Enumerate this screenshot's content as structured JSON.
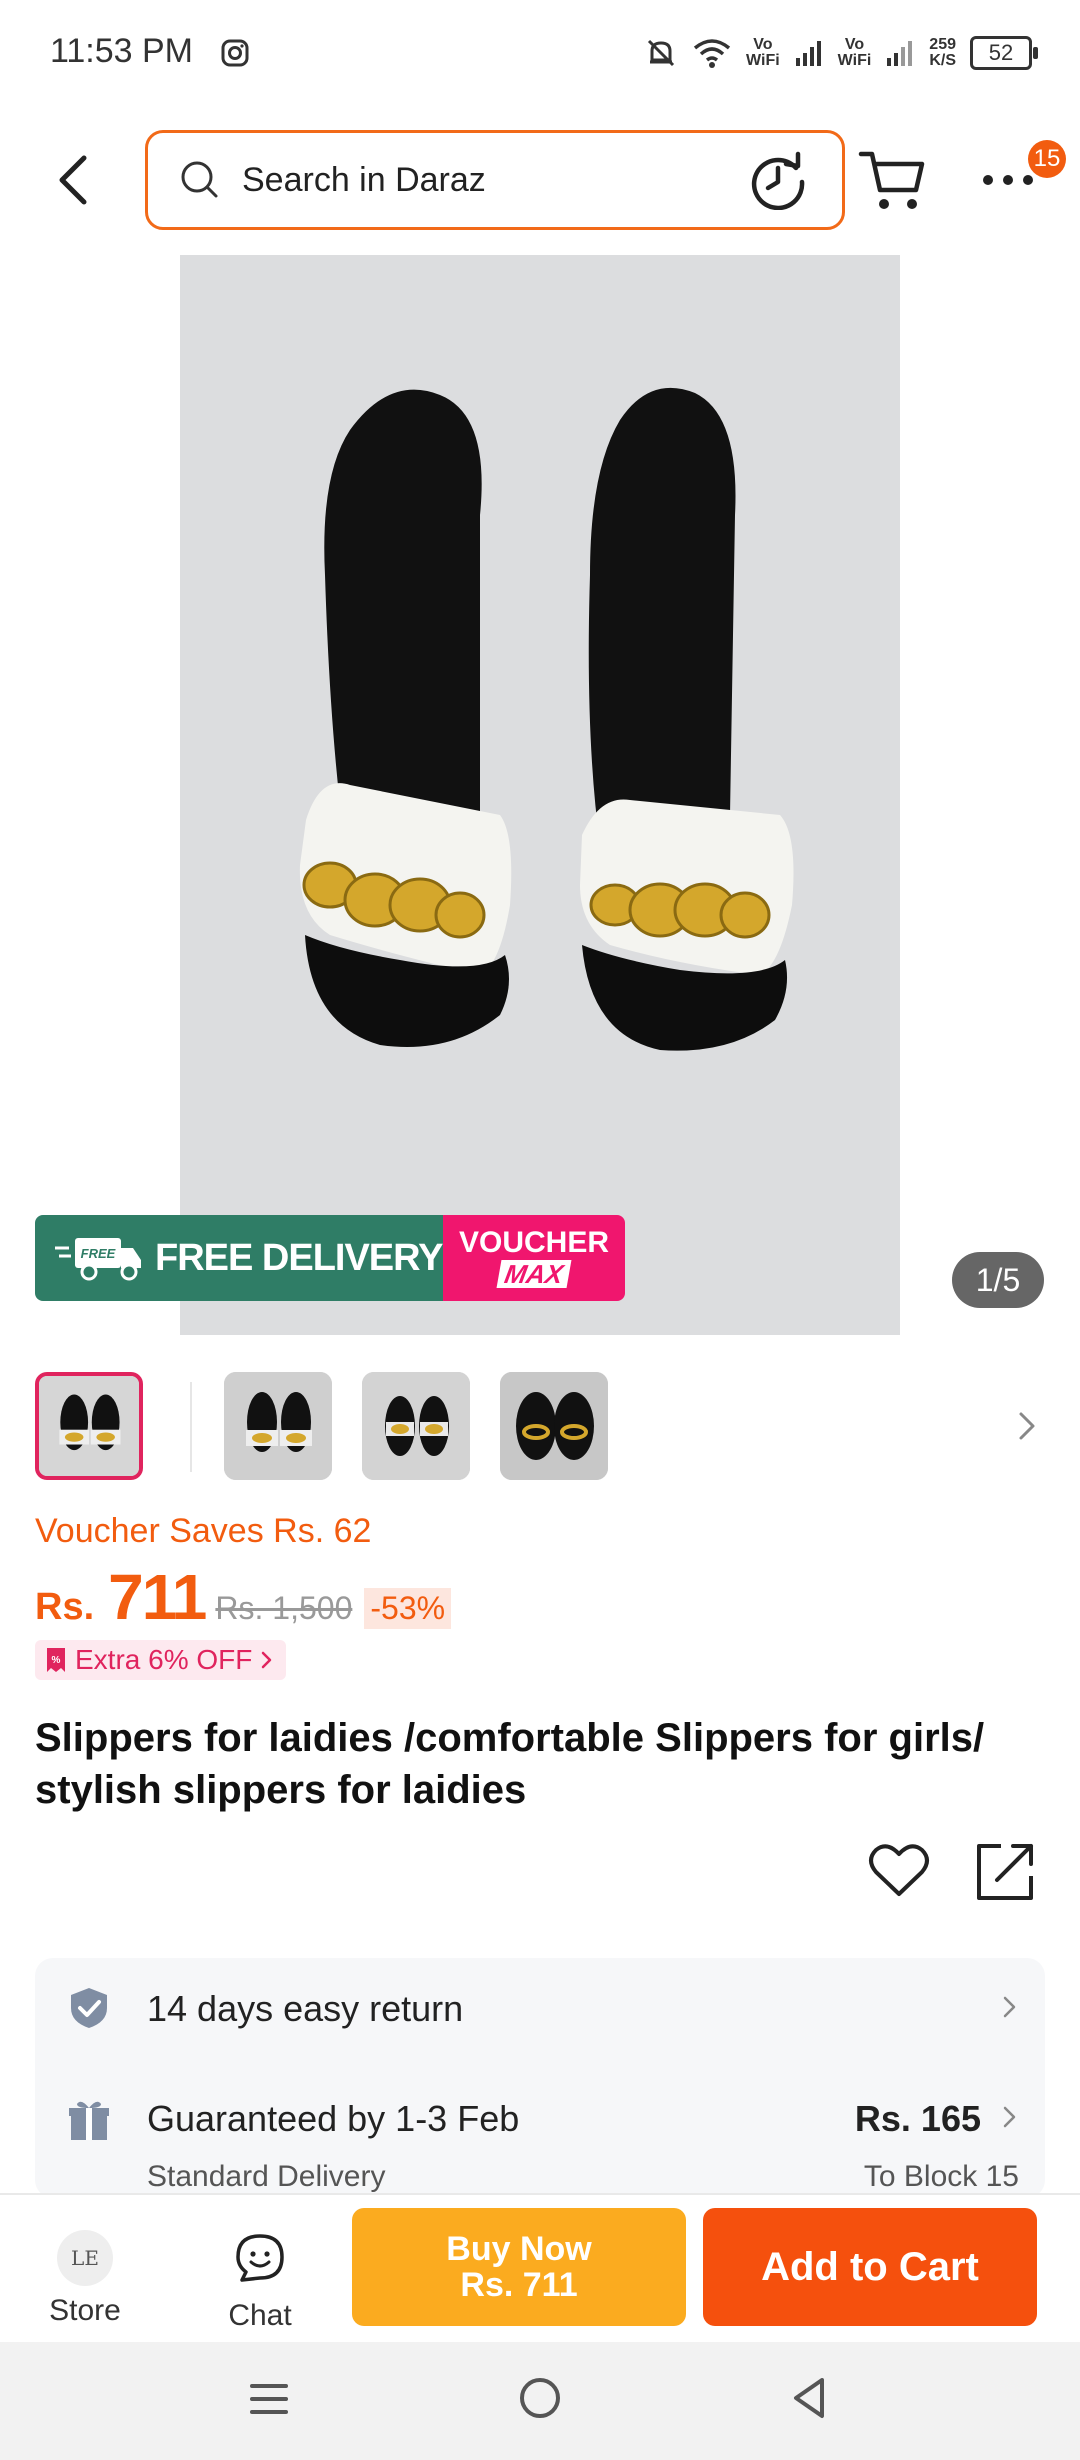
{
  "status_bar": {
    "time": "11:53 PM",
    "network_1_top": "Vo",
    "network_1_bottom": "WiFi",
    "network_2_top": "Vo",
    "network_2_bottom": "WiFi",
    "speed_value": "259",
    "speed_unit": "K/S",
    "battery": "52"
  },
  "header": {
    "search_placeholder": "Search in Daraz",
    "more_badge": "15"
  },
  "gallery": {
    "counter": "1/5",
    "promo_free_badge": "FREE",
    "promo_free_text": "FREE DELIVERY",
    "promo_voucher_line1": "VOUCHER",
    "promo_voucher_line2": "MAX"
  },
  "pricing": {
    "voucher_saves": "Voucher Saves Rs. 62",
    "currency": "Rs.",
    "price": "711",
    "original_price": "Rs. 1,500",
    "discount": "-53%",
    "extra_off": "Extra 6% OFF"
  },
  "product": {
    "title": "Slippers for laidies /comfortable Slippers for girls/ stylish slippers for laidies"
  },
  "services": {
    "return_label": "14 days easy return",
    "delivery_label": "Guaranteed by 1-3 Feb",
    "delivery_price": "Rs. 165",
    "delivery_type": "Standard Delivery",
    "delivery_location": "To Block 15"
  },
  "action_bar": {
    "store_label": "Store",
    "store_avatar_text": "LE",
    "chat_label": "Chat",
    "buy_now_line1": "Buy Now",
    "buy_now_line2": "Rs. 711",
    "add_to_cart": "Add to Cart"
  },
  "colors": {
    "accent": "#f25c0f",
    "buy_now": "#fbab1f",
    "add_to_cart": "#f5500d",
    "free_delivery": "#2f7d66",
    "voucher_max": "#f0166e"
  }
}
